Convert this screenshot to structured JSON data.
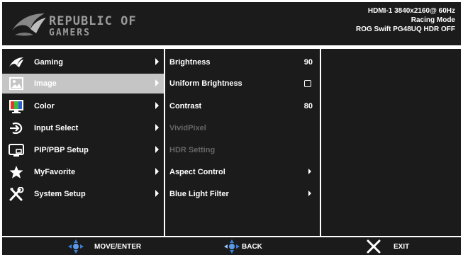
{
  "header": {
    "logo_line1": "REPUBLIC OF",
    "logo_line2": "GAMERS",
    "status_line1": "HDMI-1  3840x2160@  60Hz",
    "status_line2": "Racing Mode",
    "status_line3": "ROG Swift  PG48UQ   HDR OFF"
  },
  "menu": {
    "items": [
      {
        "label": "Gaming",
        "icon": "rog-eye-icon"
      },
      {
        "label": "Image",
        "icon": "image-icon"
      },
      {
        "label": "Color",
        "icon": "color-icon"
      },
      {
        "label": "Input Select",
        "icon": "input-select-icon"
      },
      {
        "label": "PIP/PBP Setup",
        "icon": "pip-pbp-icon"
      },
      {
        "label": "MyFavorite",
        "icon": "star-icon"
      },
      {
        "label": "System Setup",
        "icon": "tools-icon"
      }
    ],
    "selected": "Image"
  },
  "submenu": {
    "items": [
      {
        "label": "Brightness",
        "value": "90"
      },
      {
        "label": "Uniform Brightness",
        "value": ""
      },
      {
        "label": "Contrast",
        "value": "80"
      },
      {
        "label": "VividPixel",
        "value": ""
      },
      {
        "label": "HDR Setting",
        "value": ""
      },
      {
        "label": "Aspect Control",
        "value": ""
      },
      {
        "label": "Blue Light Filter",
        "value": ""
      }
    ]
  },
  "footer": {
    "move_enter": "MOVE/ENTER",
    "back": "BACK",
    "exit": "EXIT"
  },
  "colors": {
    "panel_bg": "#1b1b1b",
    "selected_bg": "#c5c5c5",
    "dpad_blue": "#3a7ed8",
    "disabled_text": "#666666"
  }
}
